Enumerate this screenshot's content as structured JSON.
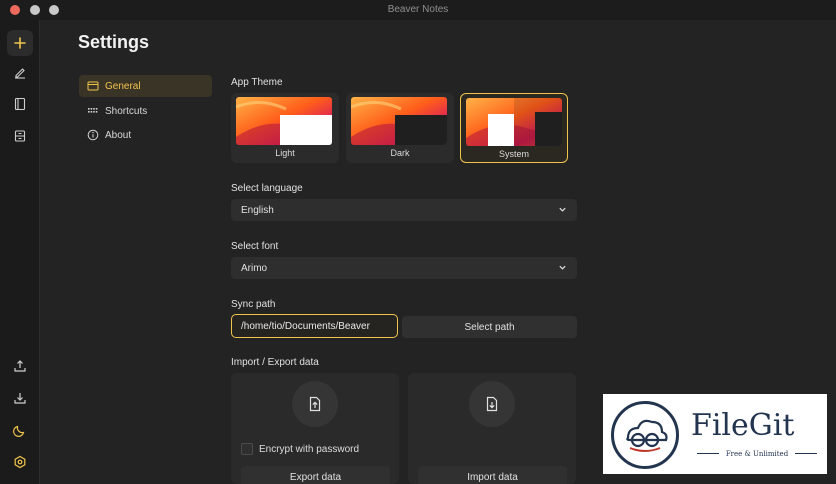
{
  "window": {
    "title": "Beaver Notes"
  },
  "rail": {
    "top_icons": [
      "plus-icon",
      "pencil-icon",
      "book-icon",
      "archive-icon"
    ],
    "bottom_icons": [
      "upload-icon",
      "download-icon",
      "moon-icon",
      "gear-icon"
    ]
  },
  "page": {
    "title": "Settings"
  },
  "nav": {
    "items": [
      {
        "label": "General",
        "icon": "window-icon",
        "active": true
      },
      {
        "label": "Shortcuts",
        "icon": "keyboard-icon",
        "active": false
      },
      {
        "label": "About",
        "icon": "info-icon",
        "active": false
      }
    ]
  },
  "theme": {
    "label": "App Theme",
    "options": [
      {
        "name": "Light",
        "selected": false
      },
      {
        "name": "Dark",
        "selected": false
      },
      {
        "name": "System",
        "selected": true
      }
    ]
  },
  "language": {
    "label": "Select language",
    "value": "English"
  },
  "font": {
    "label": "Select font",
    "value": "Arimo"
  },
  "sync": {
    "label": "Sync path",
    "value": "/home/tio/Documents/Beaver",
    "button": "Select path"
  },
  "import_export": {
    "label": "Import / Export data",
    "encrypt_label": "Encrypt with password",
    "export_button": "Export data",
    "import_button": "Import data"
  },
  "watermark": {
    "brand": "FileGit",
    "tagline": "Free & Unlimited"
  },
  "colors": {
    "accent": "#f0c44c",
    "background": "#232323",
    "rail": "#1b1b1b",
    "panel": "#2a2a2a"
  }
}
